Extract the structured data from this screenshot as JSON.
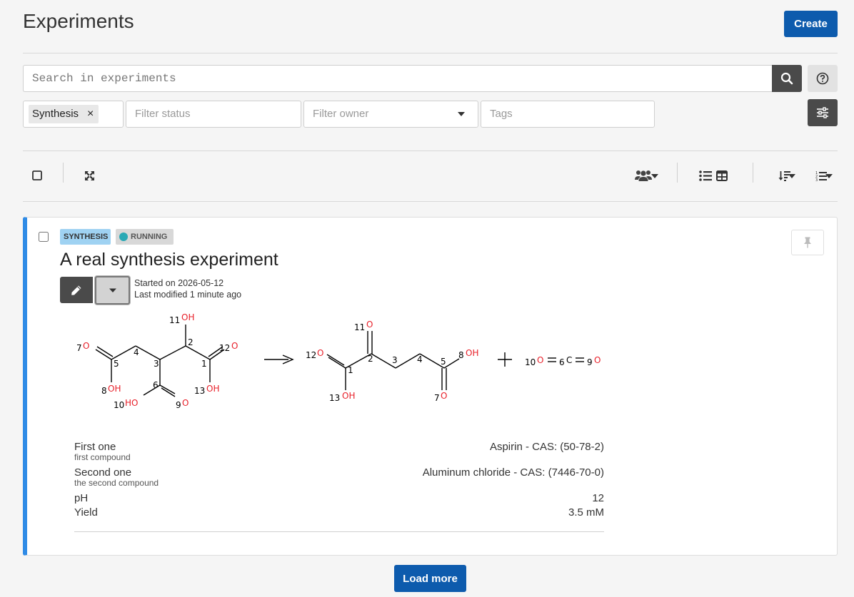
{
  "page": {
    "title": "Experiments",
    "create_label": "Create"
  },
  "search": {
    "placeholder": "Search in experiments",
    "value": ""
  },
  "filters": {
    "category_tag": "Synthesis",
    "category_remove": "×",
    "status_placeholder": "Filter status",
    "owner_placeholder": "Filter owner",
    "tags_placeholder": "Tags"
  },
  "icons": {
    "search": "search-icon",
    "help": "question-circle-icon",
    "advanced": "sliders-icon",
    "select_all": "checkbox-icon",
    "expand": "expand-icon",
    "visibility": "users-icon",
    "list_view": "list-icon",
    "table_view": "table-icon",
    "sort_order": "sort-desc-icon",
    "sort_field": "ordered-list-icon",
    "pin": "thumbtack-icon",
    "edit": "pencil-icon",
    "more": "caret-down-icon"
  },
  "colors": {
    "primary": "#0d5bad",
    "card_accent": "#2f8be6",
    "category_badge": "#9fd2f2",
    "status_dot": "#29a9b5",
    "atom_oxygen": "#e8202a"
  },
  "experiment": {
    "category": "SYNTHESIS",
    "status": "RUNNING",
    "title": "A real synthesis experiment",
    "started": "Started on 2026-05-12",
    "modified": "Last modified 1 minute ago",
    "fields": [
      {
        "name": "First one",
        "description": "first compound",
        "value": "Aspirin - CAS: (50-78-2)"
      },
      {
        "name": "Second one",
        "description": "the second compound",
        "value": "Aluminum chloride - CAS: (7446-70-0)"
      },
      {
        "name": "pH",
        "description": "",
        "value": "12"
      },
      {
        "name": "Yield",
        "description": "",
        "value": "3.5 mM"
      }
    ]
  },
  "reaction": {
    "reactant": {
      "labels": [
        "7",
        "O",
        "5",
        "4",
        "3",
        "11",
        "OH",
        "2",
        "12",
        "O",
        "1",
        "8",
        "OH",
        "6",
        "13",
        "OH",
        "10",
        "HO",
        "9",
        "O"
      ]
    },
    "product_1": {
      "labels": [
        "11",
        "O",
        "12",
        "O",
        "2",
        "1",
        "3",
        "4",
        "5",
        "8",
        "OH",
        "13",
        "OH",
        "7",
        "O"
      ]
    },
    "product_2": {
      "labels": [
        "10",
        "O",
        "=",
        "6",
        "C",
        "=",
        "9",
        "O"
      ]
    },
    "plus": "+"
  },
  "load_more_label": "Load more"
}
